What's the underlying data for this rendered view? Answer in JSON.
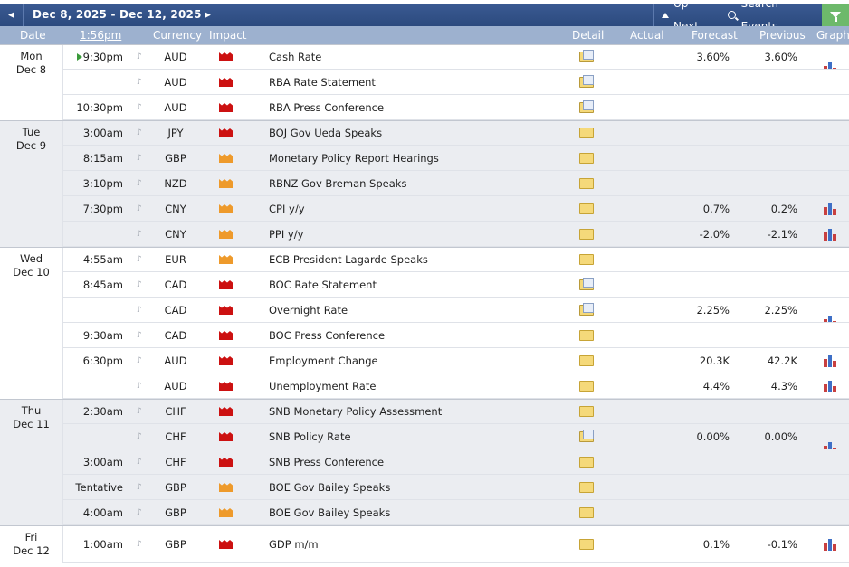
{
  "nav": {
    "date_range": "Dec 8, 2025 - Dec 12, 2025",
    "up_next_label": "Up Next",
    "search_label": "Search Events",
    "prev_icon": "chevron-left-icon",
    "next_icon": "chevron-right-icon",
    "filter_icon": "filter-icon"
  },
  "columns": {
    "date": "Date",
    "time": "1:56pm",
    "currency": "Currency",
    "impact": "Impact",
    "detail": "Detail",
    "actual": "Actual",
    "forecast": "Forecast",
    "previous": "Previous",
    "graph": "Graph"
  },
  "colors": {
    "header_blue": "#2c4a7e",
    "column_header": "#9db1cf",
    "high_impact": "#cc1111",
    "medium_impact": "#ee9a2b",
    "filter_green": "#6db96b"
  },
  "days": [
    {
      "weekday": "Mon",
      "date": "Dec 8"
    },
    {
      "weekday": "Tue",
      "date": "Dec 9"
    },
    {
      "weekday": "Wed",
      "date": "Dec 10"
    },
    {
      "weekday": "Thu",
      "date": "Dec 11"
    },
    {
      "weekday": "Fri",
      "date": "Dec 12"
    }
  ],
  "events": [
    {
      "time": "9:30pm",
      "currency": "AUD",
      "impact": "high",
      "event": "Cash Rate",
      "detail": "folder-blue-icon",
      "forecast": "3.60%",
      "previous": "3.60%",
      "graph": true,
      "next": true
    },
    {
      "time": "",
      "currency": "AUD",
      "impact": "high",
      "event": "RBA Rate Statement",
      "detail": "folder-blue-icon",
      "forecast": "",
      "previous": "",
      "graph": false
    },
    {
      "time": "10:30pm",
      "currency": "AUD",
      "impact": "high",
      "event": "RBA Press Conference",
      "detail": "folder-blue-icon",
      "forecast": "",
      "previous": "",
      "graph": false
    },
    {
      "time": "3:00am",
      "currency": "JPY",
      "impact": "high",
      "event": "BOJ Gov Ueda Speaks",
      "detail": "folder-icon",
      "forecast": "",
      "previous": "",
      "graph": false
    },
    {
      "time": "8:15am",
      "currency": "GBP",
      "impact": "medium",
      "event": "Monetary Policy Report Hearings",
      "detail": "folder-icon",
      "forecast": "",
      "previous": "",
      "graph": false
    },
    {
      "time": "3:10pm",
      "currency": "NZD",
      "impact": "medium",
      "event": "RBNZ Gov Breman Speaks",
      "detail": "folder-icon",
      "forecast": "",
      "previous": "",
      "graph": false
    },
    {
      "time": "7:30pm",
      "currency": "CNY",
      "impact": "medium",
      "event": "CPI y/y",
      "detail": "folder-icon",
      "forecast": "0.7%",
      "previous": "0.2%",
      "graph": true
    },
    {
      "time": "",
      "currency": "CNY",
      "impact": "medium",
      "event": "PPI y/y",
      "detail": "folder-icon",
      "forecast": "-2.0%",
      "previous": "-2.1%",
      "graph": true
    },
    {
      "time": "4:55am",
      "currency": "EUR",
      "impact": "medium",
      "event": "ECB President Lagarde Speaks",
      "detail": "folder-icon",
      "forecast": "",
      "previous": "",
      "graph": false
    },
    {
      "time": "8:45am",
      "currency": "CAD",
      "impact": "high",
      "event": "BOC Rate Statement",
      "detail": "folder-blue-icon",
      "forecast": "",
      "previous": "",
      "graph": false
    },
    {
      "time": "",
      "currency": "CAD",
      "impact": "high",
      "event": "Overnight Rate",
      "detail": "folder-blue-icon",
      "forecast": "2.25%",
      "previous": "2.25%",
      "graph": true
    },
    {
      "time": "9:30am",
      "currency": "CAD",
      "impact": "high",
      "event": "BOC Press Conference",
      "detail": "folder-icon",
      "forecast": "",
      "previous": "",
      "graph": false
    },
    {
      "time": "6:30pm",
      "currency": "AUD",
      "impact": "high",
      "event": "Employment Change",
      "detail": "folder-icon",
      "forecast": "20.3K",
      "previous": "42.2K",
      "graph": true
    },
    {
      "time": "",
      "currency": "AUD",
      "impact": "high",
      "event": "Unemployment Rate",
      "detail": "folder-icon",
      "forecast": "4.4%",
      "previous": "4.3%",
      "graph": true
    },
    {
      "time": "2:30am",
      "currency": "CHF",
      "impact": "high",
      "event": "SNB Monetary Policy Assessment",
      "detail": "folder-icon",
      "forecast": "",
      "previous": "",
      "graph": false
    },
    {
      "time": "",
      "currency": "CHF",
      "impact": "high",
      "event": "SNB Policy Rate",
      "detail": "folder-blue-icon",
      "forecast": "0.00%",
      "previous": "0.00%",
      "graph": true
    },
    {
      "time": "3:00am",
      "currency": "CHF",
      "impact": "high",
      "event": "SNB Press Conference",
      "detail": "folder-icon",
      "forecast": "",
      "previous": "",
      "graph": false
    },
    {
      "time": "Tentative",
      "currency": "GBP",
      "impact": "medium",
      "event": "BOE Gov Bailey Speaks",
      "detail": "folder-icon",
      "forecast": "",
      "previous": "",
      "graph": false
    },
    {
      "time": "4:00am",
      "currency": "GBP",
      "impact": "medium",
      "event": "BOE Gov Bailey Speaks",
      "detail": "folder-icon",
      "forecast": "",
      "previous": "",
      "graph": false
    },
    {
      "time": "1:00am",
      "currency": "GBP",
      "impact": "high",
      "event": "GDP m/m",
      "detail": "folder-icon",
      "forecast": "0.1%",
      "previous": "-0.1%",
      "graph": true
    }
  ]
}
